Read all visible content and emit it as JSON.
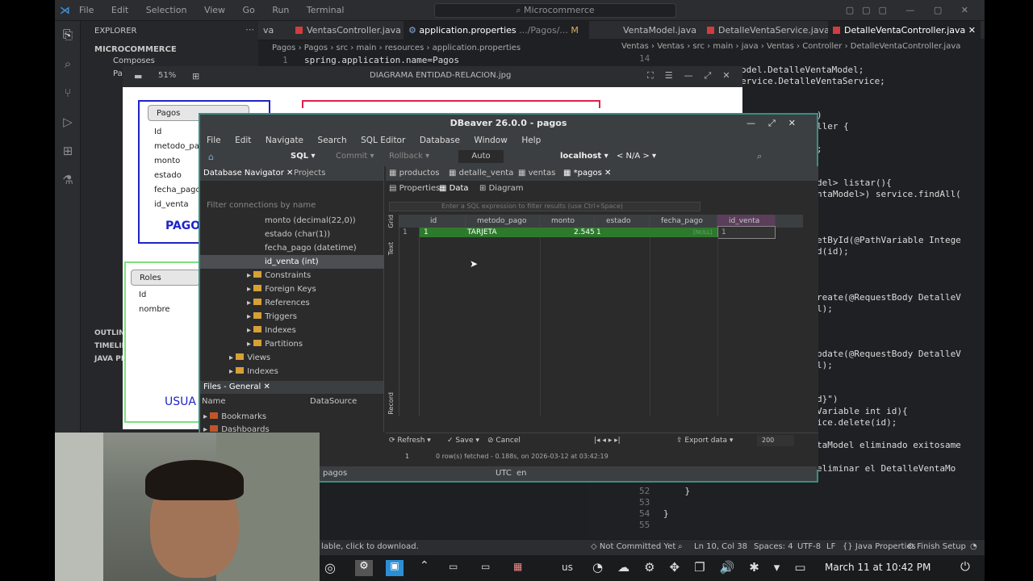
{
  "vscode": {
    "menu": [
      "File",
      "Edit",
      "Selection",
      "View",
      "Go",
      "Run",
      "Terminal"
    ],
    "search": "Microcommerce",
    "tabs": [
      {
        "label": "va",
        "active": false
      },
      {
        "label": "VentasController.java",
        "active": false
      },
      {
        "label": "application.properties",
        "path": ".../Pagos/...",
        "mark": "M",
        "active": true
      },
      {
        "label": "VentaModel.java",
        "active": false
      },
      {
        "label": "DetalleVentaService.java",
        "active": false
      },
      {
        "label": "DetalleVentaController.java",
        "active": false
      }
    ],
    "breadcrumb_left": [
      "Pagos",
      "Pagos",
      "src",
      "main",
      "resources",
      "application.properties"
    ],
    "code_left_line": "1",
    "code_left": "spring.application.name=Pagos",
    "breadcrumb_right": [
      "Ventas",
      "Ventas",
      "src",
      "main",
      "java",
      "Ventas",
      "Controller",
      "DetalleVentaController.java"
    ],
    "right_top_line": "14",
    "right_code": [
      "odel.DetalleVentaModel;",
      "ervice.DetalleVentaService;",
      ")",
      "ller {",
      ";",
      "del> listar(){",
      "ntaModel>) service.findAll(",
      "etById(@PathVariable Intege",
      "d(id);",
      "reate(@RequestBody DetalleV",
      "l);",
      "pdate(@RequestBody DetalleV",
      "l);",
      "d}\")",
      "Variable int id){",
      "ice.delete(id);",
      "taModel eliminado exitosame",
      "eliminar el DetalleVentaMo"
    ],
    "tail_lines": [
      {
        "num": "52",
        "text": "    }"
      },
      {
        "num": "53",
        "text": ""
      },
      {
        "num": "54",
        "text": "}"
      },
      {
        "num": "55",
        "text": ""
      }
    ],
    "explorer": {
      "header": "EXPLORER",
      "project": "MICROCOMMERCE",
      "items": [
        "Composes",
        "Pa"
      ],
      "outline": "OUTLINE",
      "timeline": "TIMELINE",
      "java_projects": "JAVA PRO"
    },
    "status": {
      "left": "lable, click to download.",
      "commit": "Not Committed Yet",
      "position": "Ln 10, Col 38",
      "spaces": "Spaces: 4",
      "encoding": "UTF-8",
      "eol": "LF",
      "language": "Java Properties",
      "setup": "Finish Setup"
    }
  },
  "image_viewer": {
    "title": "DIAGRAMA ENTIDAD-RELACION.jpg",
    "zoom": "51%",
    "pagos_table": {
      "title": "Pagos",
      "fields": [
        "Id",
        "metodo_pag",
        "monto",
        "estado",
        "fecha_pago",
        "id_venta"
      ],
      "label": "PAGO"
    },
    "roles_table": {
      "title": "Roles",
      "fields": [
        "Id",
        "nombre"
      ]
    },
    "usua_label": "USUA"
  },
  "dbeaver": {
    "title": "DBeaver 26.0.0 - pagos",
    "menu": [
      "File",
      "Edit",
      "Navigate",
      "Search",
      "SQL Editor",
      "Database",
      "Window",
      "Help"
    ],
    "toolbar": {
      "sql": "SQL",
      "commit": "Commit",
      "rollback": "Rollback",
      "auto": "Auto",
      "connection": "localhost",
      "schema": "< N/A >"
    },
    "navigator": {
      "tabs": [
        "Database Navigator",
        "Projects"
      ],
      "filter_placeholder": "Filter connections by name",
      "columns": [
        "monto (decimal(22,0))",
        "estado (char(1))",
        "fecha_pago (datetime)",
        "id_venta (int)"
      ],
      "folders": [
        "Constraints",
        "Foreign Keys",
        "References",
        "Triggers",
        "Indexes",
        "Partitions"
      ],
      "views": "Views",
      "indexes": "Indexes"
    },
    "files": {
      "tab": "Files - General",
      "col_name": "Name",
      "col_source": "DataSource",
      "items": [
        "Bookmarks",
        "Dashboards"
      ]
    },
    "editor_tabs": [
      "productos",
      "detalle_venta",
      "ventas",
      "*pagos"
    ],
    "sub_tabs": [
      "Properties",
      "Data",
      "Diagram"
    ],
    "filter_placeholder": "Enter a SQL expression to filter results (use Ctrl+Space)",
    "grid": {
      "side_labels": [
        "Grid",
        "Text",
        "Record"
      ],
      "columns": [
        "id",
        "metodo_pago",
        "monto",
        "estado",
        "fecha_pago",
        "id_venta"
      ],
      "rows": [
        {
          "num": "1",
          "id": "1",
          "metodo_pago": "TARJETA",
          "monto": "2.545",
          "estado": "1",
          "fecha_pago": "[NULL]",
          "id_venta": "1"
        }
      ]
    },
    "bottom": {
      "refresh": "Refresh",
      "save": "Save",
      "cancel": "Cancel",
      "export": "Export data",
      "limit": "200",
      "row": "1",
      "fetched": "0 row(s) fetched - 0.188s, on 2026-03-12 at 03:42:19"
    },
    "status": {
      "schema": "pagos",
      "tz": "UTC",
      "lang": "en"
    }
  },
  "taskbar": {
    "keyboard": "us",
    "datetime": "March 11 at 10:42 PM"
  }
}
